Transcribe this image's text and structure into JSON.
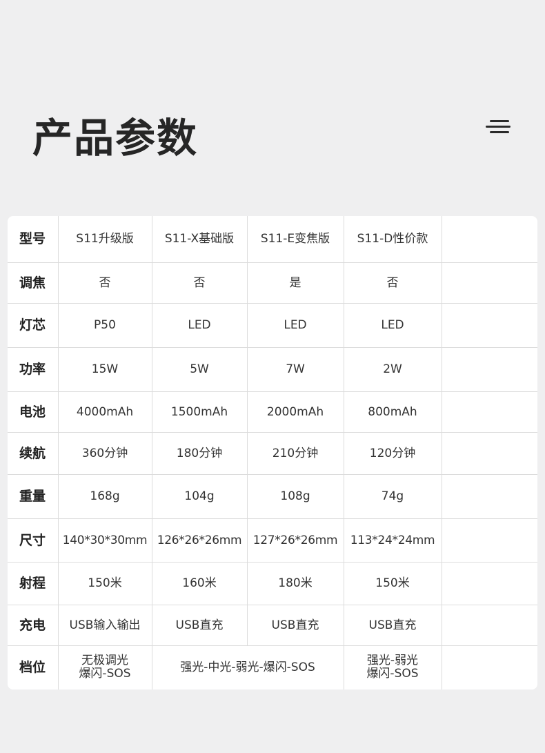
{
  "page": {
    "title": "产品参数"
  },
  "table": {
    "rows": [
      {
        "label": "型号",
        "cells": [
          "S11升级版",
          "S11-X基础版",
          "S11-E变焦版",
          "S11-D性价款"
        ]
      },
      {
        "label": "调焦",
        "cells": [
          "否",
          "否",
          "是",
          "否"
        ]
      },
      {
        "label": "灯芯",
        "cells": [
          "P50",
          "LED",
          "LED",
          "LED"
        ]
      },
      {
        "label": "功率",
        "cells": [
          "15W",
          "5W",
          "7W",
          "2W"
        ]
      },
      {
        "label": "电池",
        "cells": [
          "4000mAh",
          "1500mAh",
          "2000mAh",
          "800mAh"
        ]
      },
      {
        "label": "续航",
        "cells": [
          "360分钟",
          "180分钟",
          "210分钟",
          "120分钟"
        ]
      },
      {
        "label": "重量",
        "cells": [
          "168g",
          "104g",
          "108g",
          "74g"
        ]
      },
      {
        "label": "尺寸",
        "cells": [
          "140*30*30mm",
          "126*26*26mm",
          "127*26*26mm",
          "113*24*24mm"
        ]
      },
      {
        "label": "射程",
        "cells": [
          "150米",
          "160米",
          "180米",
          "150米"
        ]
      },
      {
        "label": "充电",
        "cells": [
          "USB输入输出",
          "USB直充",
          "USB直充",
          "USB直充"
        ]
      },
      {
        "label": "档位",
        "cells": [
          "无极调光\n爆闪-SOS",
          "强光-中光-弱光-爆闪-SOS",
          "强光-弱光\n爆闪-SOS"
        ]
      }
    ]
  }
}
